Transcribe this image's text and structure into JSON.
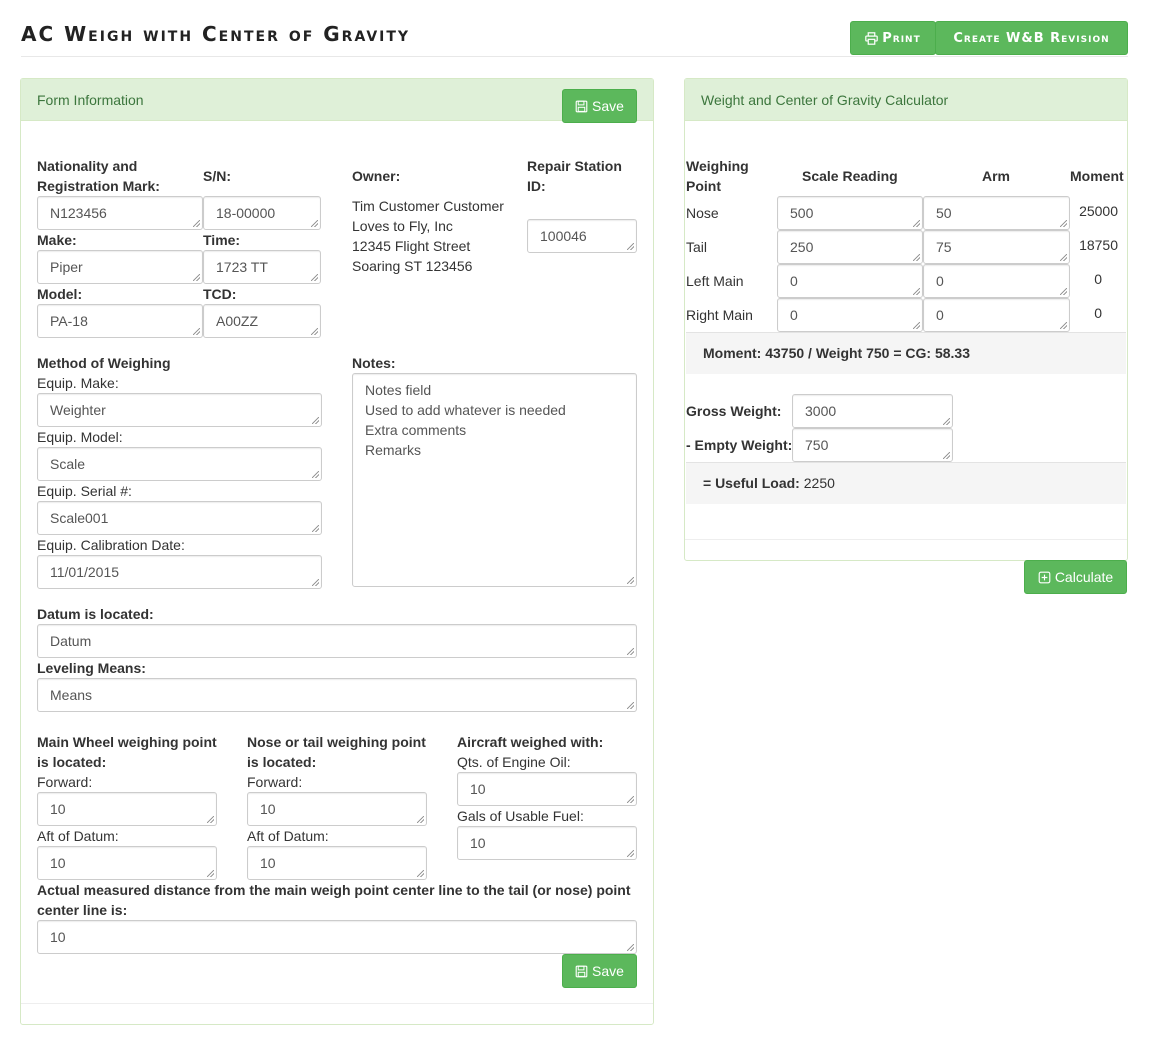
{
  "header": {
    "title": "AC Weigh with Center of Gravity",
    "print_label": "Print",
    "revision_label": "Create W&B Revision"
  },
  "form_panel": {
    "title": "Form Information",
    "save_label": "Save",
    "nationality_label": "Nationality and Registration Mark:",
    "nationality_value": "N123456",
    "sn_label": "S/N:",
    "sn_value": "18-00000",
    "make_label": "Make:",
    "make_value": "Piper",
    "time_label": "Time:",
    "time_value": "1723 TT",
    "model_label": "Model:",
    "model_value": "PA-18",
    "tcd_label": "TCD:",
    "tcd_value": "A00ZZ",
    "owner_label": "Owner:",
    "owner_lines": [
      "Tim Customer Customer",
      "Loves to Fly, Inc",
      "12345 Flight Street",
      "Soaring ST 123456"
    ],
    "repair_label": "Repair Station ID:",
    "repair_value": "100046",
    "method_label": "Method of Weighing",
    "equip_make_label": "Equip. Make:",
    "equip_make_value": "Weighter",
    "equip_model_label": "Equip. Model:",
    "equip_model_value": "Scale",
    "equip_serial_label": "Equip. Serial #:",
    "equip_serial_value": "Scale001",
    "equip_cal_label": "Equip. Calibration Date:",
    "equip_cal_value": "11/01/2015",
    "notes_label": "Notes:",
    "notes_lines": [
      "Notes field",
      "Used to add whatever is needed",
      "Extra comments",
      "Remarks"
    ],
    "datum_label": "Datum is located:",
    "datum_value": "Datum",
    "leveling_label": "Leveling Means:",
    "leveling_value": "Means",
    "main_wheel_label": "Main Wheel weighing point is located:",
    "main_fwd_label": "Forward:",
    "main_fwd_value": "10",
    "main_aft_label": "Aft of Datum:",
    "main_aft_value": "10",
    "nose_tail_label": "Nose or tail weighing point is located:",
    "nose_fwd_label": "Forward:",
    "nose_fwd_value": "10",
    "nose_aft_label": "Aft of Datum:",
    "nose_aft_value": "10",
    "weighed_with_label": "Aircraft weighed with:",
    "oil_label": "Qts. of Engine Oil:",
    "oil_value": "10",
    "fuel_label": "Gals of Usable Fuel:",
    "fuel_value": "10",
    "distance_label": "Actual measured distance from the main weigh point center line to the tail (or nose) point center line is:",
    "distance_value": "10"
  },
  "calc_panel": {
    "title": "Weight and Center of Gravity Calculator",
    "col_point": "Weighing Point",
    "col_scale": "Scale Reading",
    "col_arm": "Arm",
    "col_moment": "Moment",
    "rows": [
      {
        "point": "Nose",
        "scale": "500",
        "arm": "50",
        "moment": "25000"
      },
      {
        "point": "Tail",
        "scale": "250",
        "arm": "75",
        "moment": "18750"
      },
      {
        "point": "Left Main",
        "scale": "0",
        "arm": "0",
        "moment": "0"
      },
      {
        "point": "Right Main",
        "scale": "0",
        "arm": "0",
        "moment": "0"
      }
    ],
    "cg_summary": "Moment: 43750 / Weight 750 = CG: 58.33",
    "gross_label": "Gross Weight:",
    "gross_value": "3000",
    "empty_label": "- Empty Weight:",
    "empty_value": "750",
    "useful_label": "= Useful Load:",
    "useful_value": "2250",
    "calculate_label": "Calculate"
  }
}
